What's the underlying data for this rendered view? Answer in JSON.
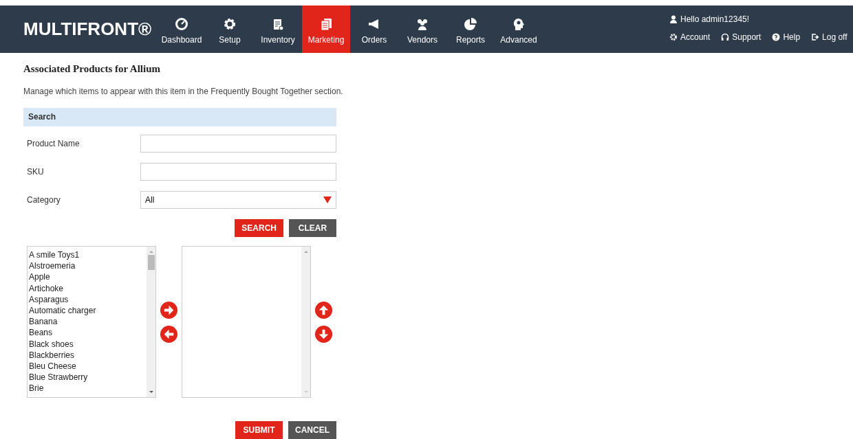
{
  "header": {
    "logo": "MULTIFRONT®",
    "nav": [
      {
        "label": "Dashboard",
        "kind": "gauge",
        "selected": false
      },
      {
        "label": "Setup",
        "kind": "gear",
        "selected": false
      },
      {
        "label": "Inventory",
        "kind": "clipboard",
        "selected": false
      },
      {
        "label": "Marketing",
        "kind": "docs",
        "selected": true
      },
      {
        "label": "Orders",
        "kind": "megaphone",
        "selected": false
      },
      {
        "label": "Vendors",
        "kind": "people",
        "selected": false
      },
      {
        "label": "Reports",
        "kind": "pie",
        "selected": false
      },
      {
        "label": "Advanced",
        "kind": "head",
        "selected": false
      }
    ],
    "greeting": "Hello admin12345!",
    "links": [
      {
        "label": "Account",
        "kind": "gear"
      },
      {
        "label": "Support",
        "kind": "headset"
      },
      {
        "label": "Help",
        "kind": "help"
      },
      {
        "label": "Log off",
        "kind": "logoff"
      }
    ]
  },
  "page": {
    "title": "Associated Products for Allium",
    "description": "Manage which items to appear with this item in the Frequently Bought Together section."
  },
  "search": {
    "heading": "Search",
    "fields": [
      {
        "label": "Product Name",
        "kind": "text"
      },
      {
        "label": "SKU",
        "kind": "text"
      },
      {
        "label": "Category",
        "kind": "select",
        "value": "All"
      }
    ],
    "buttons": [
      {
        "label": "SEARCH",
        "kind": "primary"
      },
      {
        "label": "CLEAR",
        "kind": "secondary"
      }
    ]
  },
  "available_items": [
    "A smile Toys1",
    "Alstroemeria",
    "Apple",
    "Artichoke",
    "Asparagus",
    "Automatic charger",
    "Banana",
    "Beans",
    "Black shoes",
    "Blackberries",
    "Bleu Cheese",
    "Blue Strawberry",
    "Brie"
  ],
  "buttons": [
    {
      "label": "SUBMIT",
      "kind": "primary"
    },
    {
      "label": "CANCEL",
      "kind": "secondary"
    }
  ]
}
